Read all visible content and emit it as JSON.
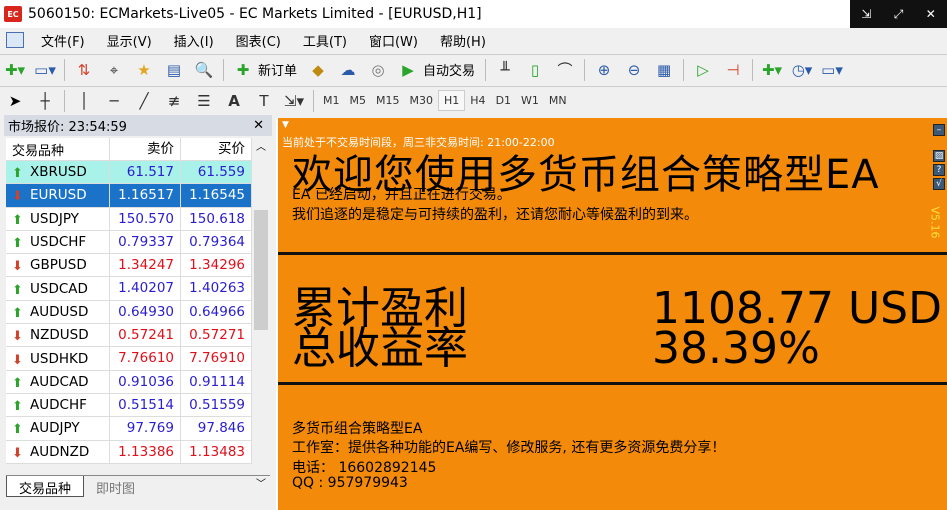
{
  "window": {
    "title": "5060150: ECMarkets-Live05 - EC Markets Limited - [EURUSD,H1]",
    "logo": "EC",
    "controls": [
      "restore",
      "maximize",
      "close"
    ]
  },
  "menu": [
    "文件(F)",
    "显示(V)",
    "插入(I)",
    "图表(C)",
    "工具(T)",
    "窗口(W)",
    "帮助(H)"
  ],
  "toolbar": {
    "new_order": "新订单",
    "auto_trade": "自动交易",
    "timeframes": [
      "M1",
      "M5",
      "M15",
      "M30",
      "H1",
      "H4",
      "D1",
      "W1",
      "MN"
    ],
    "active_tf": "H1"
  },
  "market_watch": {
    "title": "市场报价: 23:54:59",
    "headers": [
      "交易品种",
      "卖价",
      "买价"
    ],
    "rows": [
      {
        "symbol": "XBRUSD",
        "bid": "61.517",
        "ask": "61.559",
        "dir": "up",
        "color": "blue"
      },
      {
        "symbol": "EURUSD",
        "bid": "1.16517",
        "ask": "1.16545",
        "dir": "down",
        "color": "sel"
      },
      {
        "symbol": "USDJPY",
        "bid": "150.570",
        "ask": "150.618",
        "dir": "up",
        "color": "blue"
      },
      {
        "symbol": "USDCHF",
        "bid": "0.79337",
        "ask": "0.79364",
        "dir": "up",
        "color": "blue"
      },
      {
        "symbol": "GBPUSD",
        "bid": "1.34247",
        "ask": "1.34296",
        "dir": "down",
        "color": "red"
      },
      {
        "symbol": "USDCAD",
        "bid": "1.40207",
        "ask": "1.40263",
        "dir": "up",
        "color": "blue"
      },
      {
        "symbol": "AUDUSD",
        "bid": "0.64930",
        "ask": "0.64966",
        "dir": "up",
        "color": "blue"
      },
      {
        "symbol": "NZDUSD",
        "bid": "0.57241",
        "ask": "0.57271",
        "dir": "down",
        "color": "red"
      },
      {
        "symbol": "USDHKD",
        "bid": "7.76610",
        "ask": "7.76910",
        "dir": "down",
        "color": "red"
      },
      {
        "symbol": "AUDCAD",
        "bid": "0.91036",
        "ask": "0.91114",
        "dir": "up",
        "color": "blue"
      },
      {
        "symbol": "AUDCHF",
        "bid": "0.51514",
        "ask": "0.51559",
        "dir": "up",
        "color": "blue"
      },
      {
        "symbol": "AUDJPY",
        "bid": "97.769",
        "ask": "97.846",
        "dir": "up",
        "color": "blue"
      },
      {
        "symbol": "AUDNZD",
        "bid": "1.13386",
        "ask": "1.13483",
        "dir": "down",
        "color": "red"
      }
    ],
    "tabs": [
      "交易品种",
      "即时图"
    ]
  },
  "chart": {
    "status": "当前处于不交易时间段，周三非交易时间: 21:00-22:00",
    "welcome": "欢迎您使用多货币组合策略型EA",
    "line1": "EA 已经启动，并且正在进行交易。",
    "line2": "我们追逐的是稳定与可持续的盈利，还请您耐心等候盈利的到来。",
    "profit_label": "累计盈利",
    "profit_value": "1108.77 USD",
    "return_label": "总收益率",
    "return_value": "38.39%",
    "footer": [
      "多货币组合策略型EA",
      "工作室：提供各种功能的EA编写、修改服务, 还有更多资源免费分享！",
      "电话： 16602892145",
      "QQ : 957979943"
    ],
    "version": "V5.16",
    "bg": "#f38a0a"
  }
}
